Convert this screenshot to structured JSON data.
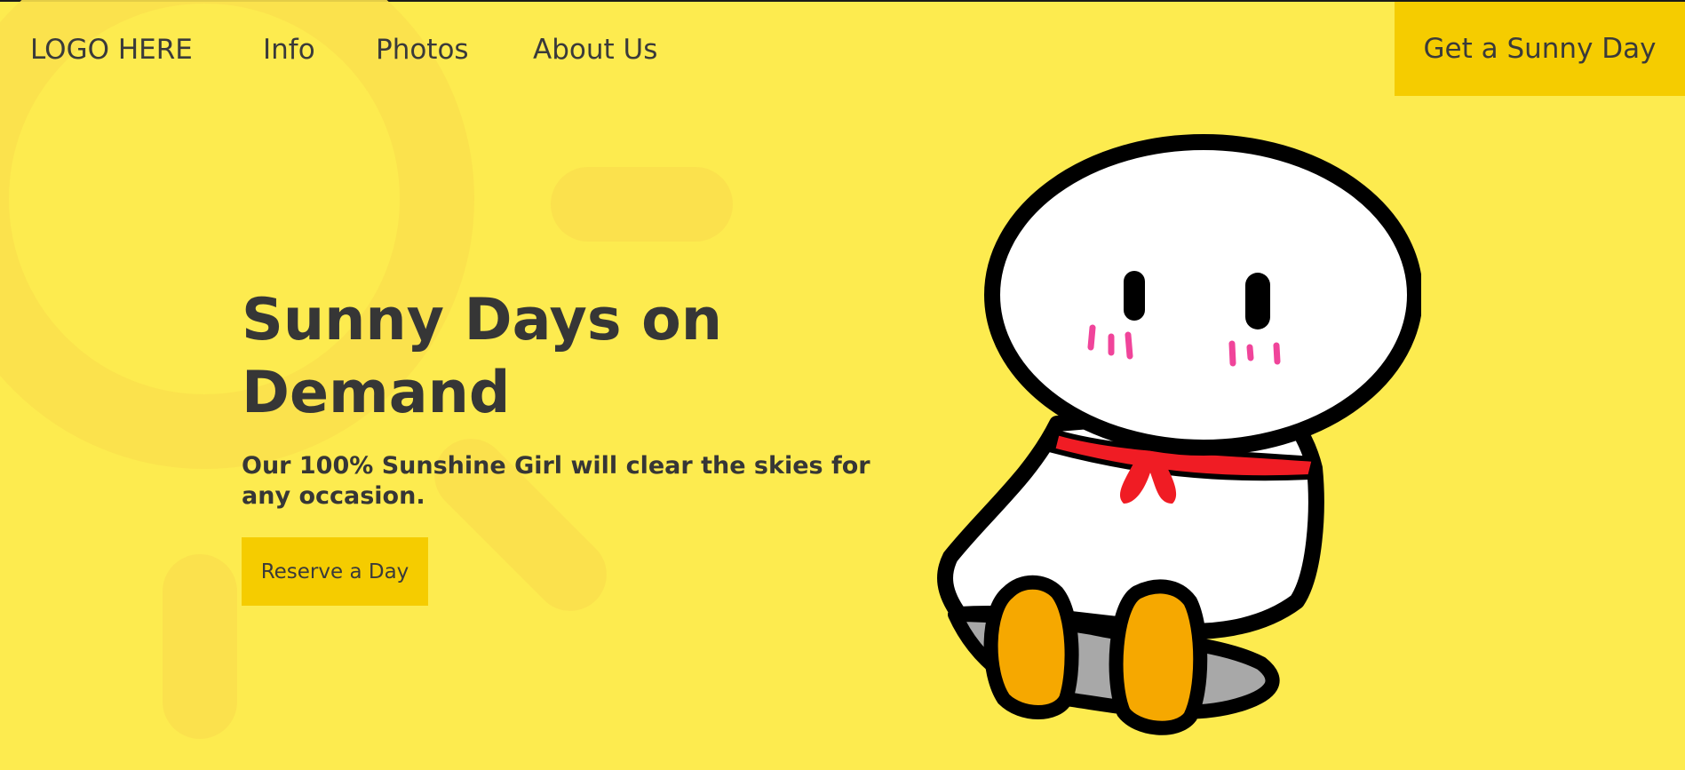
{
  "nav": {
    "logo": "LOGO HERE",
    "links": [
      "Info",
      "Photos",
      "About Us"
    ],
    "cta_label": "Get a Sunny Day"
  },
  "hero": {
    "title": "Sunny Days on Demand",
    "subtitle": "Our 100% Sunshine Girl will clear the skies for any occasion.",
    "button_label": "Reserve a Day"
  },
  "colors": {
    "background": "#fdeb4f",
    "decor": "#fbe14d",
    "accent": "#f5cc00",
    "text": "#363636",
    "scarf": "#f01c24",
    "blush": "#f0449a",
    "feet": "#f6a800"
  },
  "illustration": {
    "icon": "teru-teru-bozu-doll-icon"
  }
}
